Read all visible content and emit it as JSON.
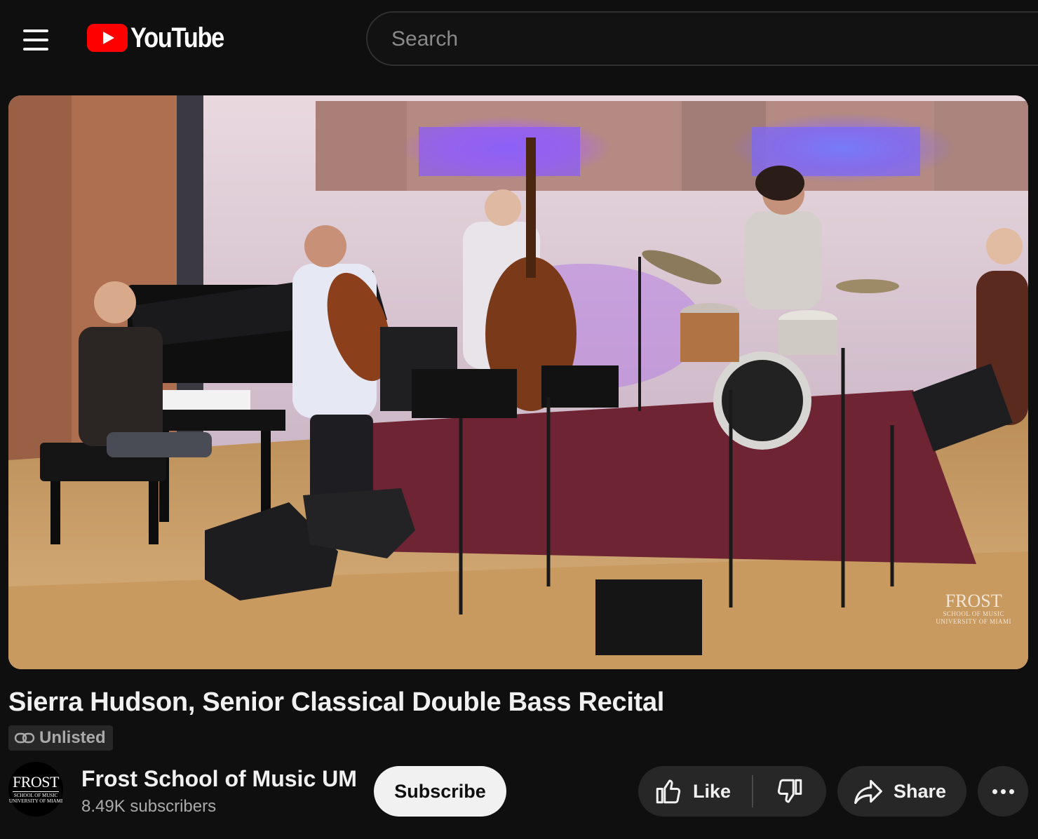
{
  "masthead": {
    "logo_text": "YouTube",
    "search_placeholder": "Search"
  },
  "player": {
    "watermark_main": "FROST",
    "watermark_sub1": "SCHOOL OF MUSIC",
    "watermark_sub2": "UNIVERSITY OF MIAMI"
  },
  "video": {
    "title": "Sierra Hudson, Senior Classical Double Bass Recital",
    "visibility_badge": "Unlisted"
  },
  "owner": {
    "avatar_main": "FROST",
    "avatar_sub1": "SCHOOL OF MUSIC",
    "avatar_sub2": "UNIVERSITY OF MIAMI",
    "channel_name": "Frost School of Music UM",
    "subscriber_count": "8.49K subscribers",
    "subscribe_label": "Subscribe"
  },
  "actions": {
    "like_label": "Like",
    "share_label": "Share"
  },
  "icons": {
    "menu": "hamburger-menu-icon",
    "logo": "youtube-play-icon",
    "badge": "link-icon",
    "like": "thumbs-up-icon",
    "dislike": "thumbs-down-icon",
    "share": "share-arrow-icon",
    "more": "more-horizontal-icon"
  },
  "colors": {
    "background": "#0f0f0f",
    "brand_red": "#ff0000",
    "pill_background": "#272727",
    "subscribe_background": "#f1f1f1",
    "secondary_text": "#aaaaaa"
  }
}
